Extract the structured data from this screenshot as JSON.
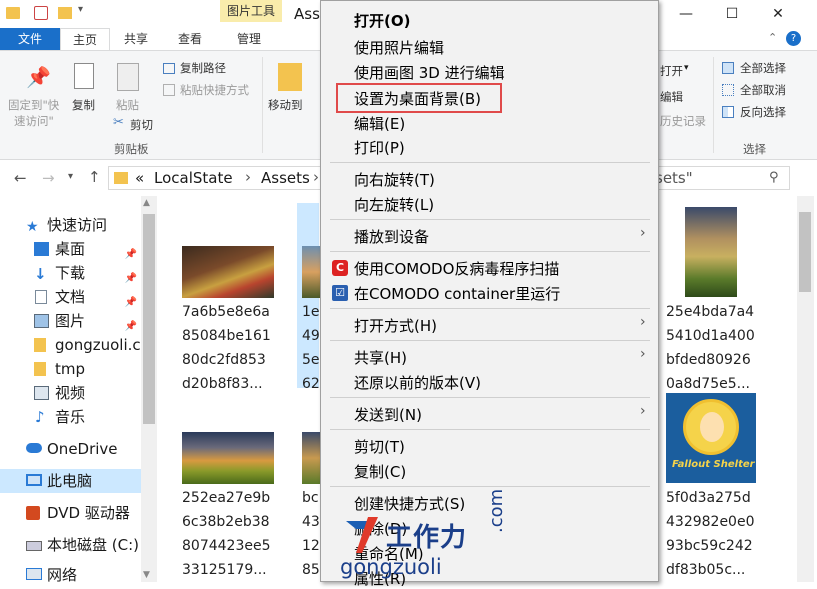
{
  "window": {
    "title_fragment": "Ass",
    "context_tab_group": "图片工具",
    "controls": {
      "minimize": "—",
      "maximize": "☐",
      "close": "✕"
    }
  },
  "ribbon_tabs": [
    "文件",
    "主页",
    "共享",
    "查看",
    "管理"
  ],
  "ribbon": {
    "pin_label_line1": "固定到\"快",
    "pin_label_line2": "速访问\"",
    "copy_label": "复制",
    "paste_label": "粘贴",
    "copy_path": "复制路径",
    "paste_shortcut": "粘贴快捷方式",
    "cut_label": "剪切",
    "clipboard_group": "剪贴板",
    "move_to": "移动到",
    "open_fragment": "打开",
    "edit_fragment": "编辑",
    "history_fragment": "历史记录",
    "select_all": "全部选择",
    "select_none": "全部取消",
    "invert_selection": "反向选择",
    "select_group": "选择"
  },
  "address": {
    "segments": [
      "«",
      "LocalState",
      "›",
      "Assets",
      "›"
    ],
    "search_fragment": "sets\""
  },
  "nav": [
    {
      "label": "快速访问",
      "icon": "star-icon",
      "pinned": false
    },
    {
      "label": "桌面",
      "icon": "desktop-icon",
      "pinned": true
    },
    {
      "label": "下载",
      "icon": "download-icon",
      "pinned": true
    },
    {
      "label": "文档",
      "icon": "document-icon",
      "pinned": true
    },
    {
      "label": "图片",
      "icon": "picture-icon",
      "pinned": true
    },
    {
      "label": "gongzuoli.c",
      "icon": "folder-icon",
      "pinned": false
    },
    {
      "label": "tmp",
      "icon": "folder-icon",
      "pinned": false
    },
    {
      "label": "视频",
      "icon": "video-icon",
      "pinned": false
    },
    {
      "label": "音乐",
      "icon": "music-icon",
      "pinned": false
    },
    {
      "label": "OneDrive",
      "icon": "cloud-icon",
      "pinned": false
    },
    {
      "label": "此电脑",
      "icon": "computer-icon",
      "pinned": false
    },
    {
      "label": "DVD 驱动器",
      "icon": "dvd-icon",
      "pinned": false
    },
    {
      "label": "本地磁盘 (C:)",
      "icon": "disk-icon",
      "pinned": false
    },
    {
      "label": "网络",
      "icon": "network-icon",
      "pinned": false
    }
  ],
  "files": [
    {
      "name": "7a6b5e8e6a\n85084be161\n80dc2fd853\nd20b8f83..."
    },
    {
      "name": "1e\n49\n5e\n62"
    },
    {
      "name": "25e4bda7a4\n5410d1a400\nbfded80926\n0a8d75e5..."
    },
    {
      "name": "252ea27e9b\n6c38b2eb38\n8074423ee5\n33125179..."
    },
    {
      "name": "bc\n43\n12\n85"
    },
    {
      "name": "5f0d3a275d\n432982e0e0\n93bc59c242\ndf83b05c..."
    }
  ],
  "file_thumbnail_text": {
    "fallout_line1": "Fallout",
    "fallout_line2": "Shelter"
  },
  "context_menu": {
    "items": [
      {
        "label": "打开(O)",
        "bold": true
      },
      {
        "label": "使用照片编辑"
      },
      {
        "label": "使用画图 3D 进行编辑"
      },
      {
        "label": "设置为桌面背景(B)",
        "highlighted": true
      },
      {
        "label": "编辑(E)"
      },
      {
        "label": "打印(P)"
      },
      {
        "label": "向右旋转(T)"
      },
      {
        "label": "向左旋转(L)"
      },
      {
        "label": "播放到设备",
        "submenu": true
      },
      {
        "label": "使用COMODO反病毒程序扫描",
        "icon": "comodo-icon"
      },
      {
        "label": "在COMODO container里运行",
        "icon": "container-icon"
      },
      {
        "label": "打开方式(H)",
        "submenu": true
      },
      {
        "label": "共享(H)",
        "submenu": true
      },
      {
        "label": "还原以前的版本(V)"
      },
      {
        "label": "发送到(N)",
        "submenu": true
      },
      {
        "label": "剪切(T)"
      },
      {
        "label": "复制(C)"
      },
      {
        "label": "创建快捷方式(S)"
      },
      {
        "label": "删除(D)"
      },
      {
        "label": "重命名(M)"
      },
      {
        "label": "属性(R)"
      }
    ],
    "submenu_arrow": "›"
  },
  "watermark": {
    "brand": "工作力",
    "domain": "gongzuoli",
    "tld": ".com"
  },
  "colors": {
    "accent": "#1a6fc9",
    "highlight_box": "#e04a4a",
    "selection": "#cce8ff"
  }
}
